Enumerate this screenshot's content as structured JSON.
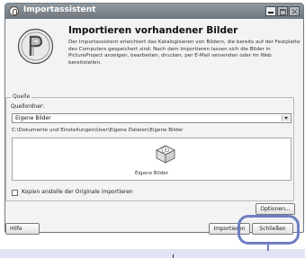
{
  "window": {
    "title": "Importassistent"
  },
  "header": {
    "heading": "Importieren vorhandener Bilder",
    "description": "Der Importassistent erleichtert das Katalogisieren von Bildern, die bereits auf der Festplatte des Computers gespeichert sind. Nach dem Importieren lassen sich die Bilder in PictureProject anzeigen, bearbeiten, drucken, per E-Mail versenden oder im Web bereitstellen."
  },
  "source": {
    "group_label": "Quelle",
    "folder_label": "Quellordner:",
    "selected_folder": "Eigene Bilder",
    "path": "C:\\Dokumente und Einstellungen\\User\\Eigene Dateien\\Eigene Bilder",
    "folder_name": "Eigene Bilder",
    "copy_label": "Kopien anstelle der Originale importieren",
    "copy_checked": false
  },
  "buttons": {
    "options": "Optionen...",
    "help": "Hilfe",
    "import": "Importieren",
    "close": "Schließen"
  },
  "highlight_color": "#6f7fc4"
}
